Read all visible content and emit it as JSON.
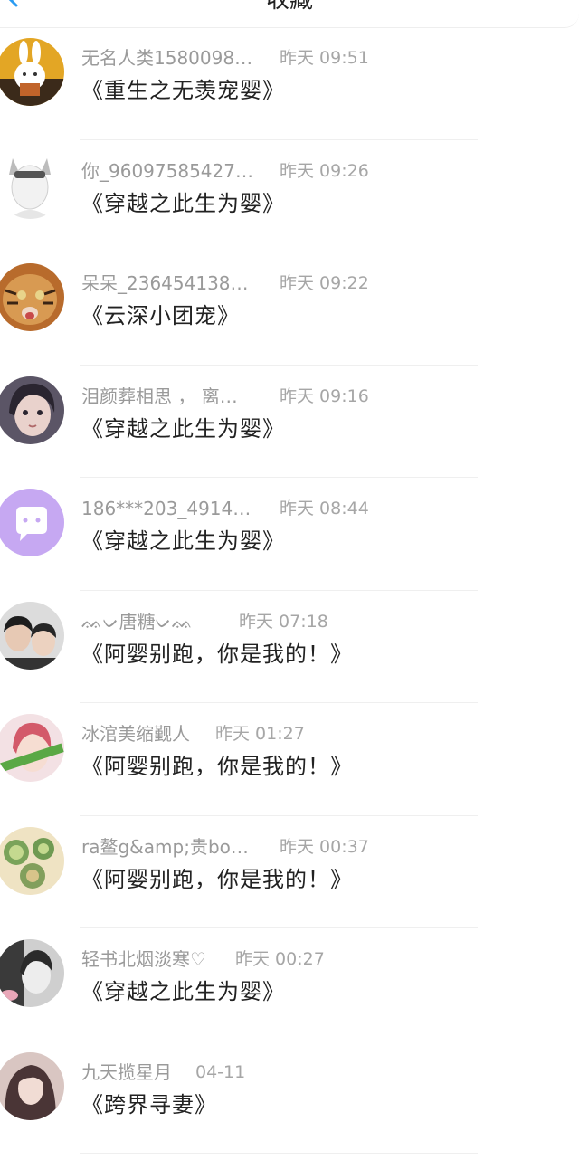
{
  "header": {
    "title": "收藏",
    "back_icon": "back-arrow-icon"
  },
  "colors": {
    "accent": "#2b9cf2",
    "name_text": "#9a9a9a",
    "title_text": "#222222",
    "divider": "#efefef"
  },
  "items": [
    {
      "name": "无名人类1580098…",
      "time": "昨天 09:51",
      "title": "《重生之无羡宠婴》",
      "avatar": "cartoon-rabbit-avatar"
    },
    {
      "name": "你_96097585427…",
      "time": "昨天 09:26",
      "title": "《穿越之此生为婴》",
      "avatar": "anime-boy-cat-ears-avatar"
    },
    {
      "name": "呆呆_236454138…",
      "time": "昨天 09:22",
      "title": "《云深小团宠》",
      "avatar": "tiger-cub-avatar"
    },
    {
      "name": "泪颜葬相思 ， 离…",
      "time": "昨天 09:16",
      "title": "《穿越之此生为婴》",
      "avatar": "girl-photo-avatar"
    },
    {
      "name": "186***203_4914…",
      "time": "昨天 08:44",
      "title": "《穿越之此生为婴》",
      "avatar": "default-chat-bubble-avatar"
    },
    {
      "name": "ᨐᨆ唐糖ᨆᨐ",
      "time": "昨天 07:18",
      "title": "《阿婴别跑，你是我的！》",
      "avatar": "friends-photo-avatar"
    },
    {
      "name": "冰涫美缩觐人",
      "time": "昨天 01:27",
      "title": "《阿婴别跑，你是我的！》",
      "avatar": "pink-hair-avatar"
    },
    {
      "name": "ra鳌g&amp;贵bo…",
      "time": "昨天 00:37",
      "title": "《阿婴别跑，你是我的！》",
      "avatar": "sweets-avatar"
    },
    {
      "name": "轻书北烟淡寒♡",
      "time": "昨天 00:27",
      "title": "《穿越之此生为婴》",
      "avatar": "monochrome-girl-avatar"
    },
    {
      "name": "九天揽星月",
      "time": "04-11",
      "title": "《跨界寻妻》",
      "avatar": "long-hair-girl-avatar"
    }
  ]
}
